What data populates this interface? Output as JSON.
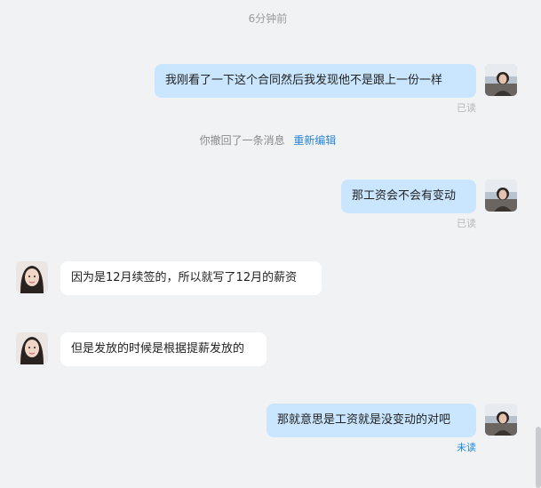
{
  "chat": {
    "timestamp": "6分钟前",
    "messages": [
      {
        "direction": "out",
        "text": "我刚看了一下这个合同然后我发现他不是跟上一份一样",
        "status": "已读"
      },
      {
        "direction": "out",
        "text": "那工资会不会有变动",
        "status": "已读"
      },
      {
        "direction": "in",
        "text": "因为是12月续签的，所以就写了12月的薪资"
      },
      {
        "direction": "in",
        "text": "但是发放的时候是根据提薪发放的"
      },
      {
        "direction": "out",
        "text": "那就意思是工资就是没变动的对吧",
        "status": "未读"
      }
    ],
    "recall": {
      "notice": "你撤回了一条消息",
      "reedit_label": "重新编辑"
    }
  },
  "colors": {
    "background": "#f1f2f4",
    "outgoing_bubble": "#c9e6fe",
    "incoming_bubble": "#ffffff",
    "link": "#2a86d6",
    "unread": "#1a88e0"
  }
}
